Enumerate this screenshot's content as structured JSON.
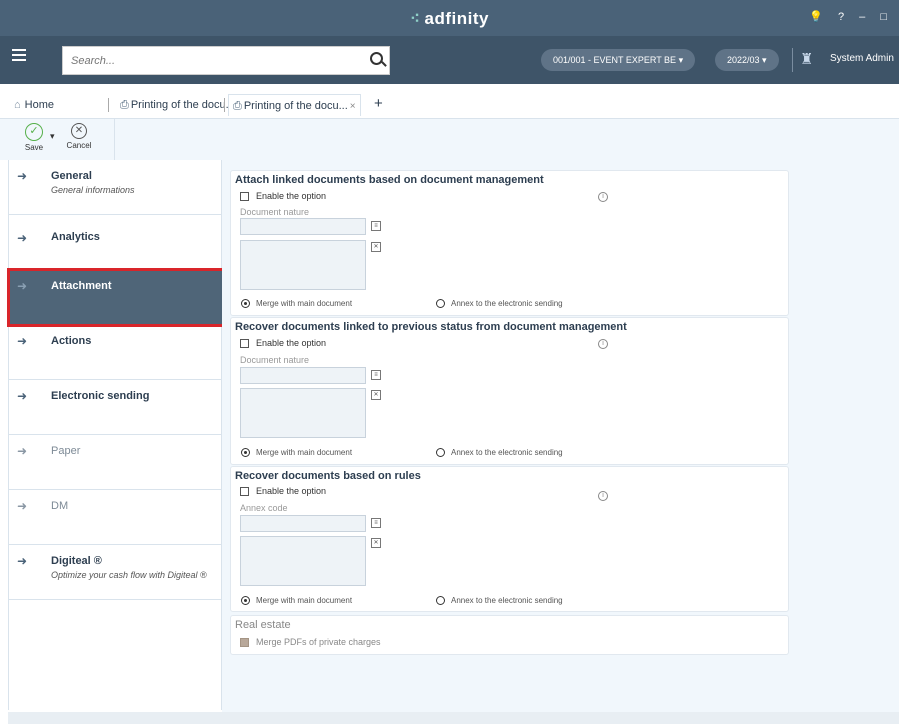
{
  "titlebar": {
    "logo": "adfinity",
    "logo_dots": "⁖",
    "controls": "? – □"
  },
  "toolbar": {
    "search_placeholder": "Search...",
    "company": "001/001 - EVENT EXPERT BE ▾",
    "period": "2022/03 ▾",
    "user": "System Admin"
  },
  "tabs": [
    {
      "label": "Home"
    },
    {
      "label": "Printing of the docu...",
      "close": "×"
    },
    {
      "label": "Printing of the docu...",
      "close": "×"
    }
  ],
  "add_tab": "+",
  "actions": {
    "save": "Save",
    "cancel": "Cancel",
    "dropdown": "▾"
  },
  "sidebar": {
    "items": [
      {
        "label": "General",
        "sub": "General informations"
      },
      {
        "label": "Analytics"
      },
      {
        "label": "Attachment"
      },
      {
        "label": "Actions"
      },
      {
        "label": "Electronic sending"
      },
      {
        "label": "Paper"
      },
      {
        "label": "DM"
      },
      {
        "label": "Digiteal ®",
        "sub": "Optimize your cash flow with Digiteal ®"
      }
    ],
    "arrow": "➜"
  },
  "cards": [
    {
      "title": "Attach linked documents based on document management",
      "option": "Enable the option",
      "field_label": "Document nature",
      "radio1": "Merge with main document",
      "radio2": "Annex to the electronic sending"
    },
    {
      "title": "Recover documents linked to previous status from document management",
      "option": "Enable the option",
      "field_label": "Document nature",
      "radio1": "Merge with main document",
      "radio2": "Annex to the electronic sending"
    },
    {
      "title": "Recover documents based on rules",
      "option": "Enable the option",
      "field_label": "Annex code",
      "radio1": "Merge with main document",
      "radio2": "Annex to the electronic sending"
    },
    {
      "title": "Real estate",
      "option": "Merge PDFs of private charges"
    }
  ],
  "info_glyph": "i",
  "colors": {
    "header": "#4a6278",
    "toolbar": "#3e5468",
    "active_item": "#4f6578",
    "highlight_border": "#d9252a",
    "save_green": "#56b04a"
  }
}
